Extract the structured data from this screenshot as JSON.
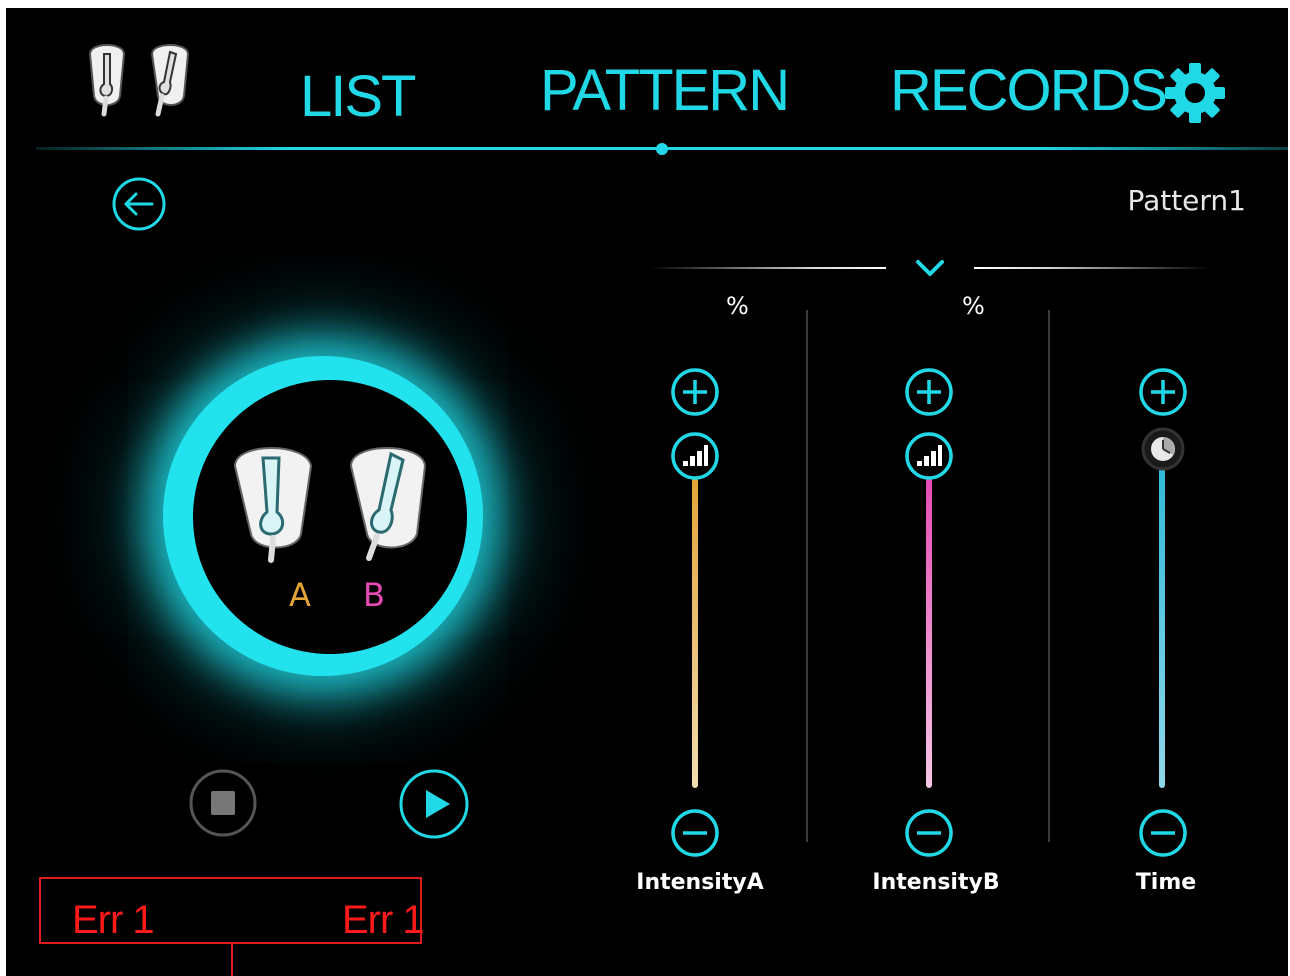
{
  "nav": {
    "tabs": [
      {
        "label": "LIST"
      },
      {
        "label": "PATTERN"
      },
      {
        "label": "RECORDS"
      }
    ],
    "active_tab": "PATTERN"
  },
  "pattern_name": "Pattern1",
  "device": {
    "channel_a": "A",
    "channel_b": "B"
  },
  "sliders": [
    {
      "name": "IntensityA",
      "unit": "%",
      "level": 1.0,
      "color": "#e3a437"
    },
    {
      "name": "IntensityB",
      "unit": "%",
      "level": 1.0,
      "color": "#e64bb4"
    },
    {
      "name": "Time",
      "unit": "",
      "level": 1.0,
      "color": "#2fb8d8"
    }
  ],
  "errors": {
    "left": "Err 1",
    "right": "Err 1"
  },
  "colors": {
    "accent": "#20d8e6",
    "channel_a": "#e3a437",
    "channel_b": "#e64bb4",
    "error": "#ff1a1a"
  },
  "icons": [
    "earphones-icon",
    "gear-icon",
    "back-arrow-icon",
    "chevron-down-icon",
    "plus-icon",
    "minus-icon",
    "signal-icon",
    "clock-icon",
    "stop-icon",
    "play-icon"
  ]
}
